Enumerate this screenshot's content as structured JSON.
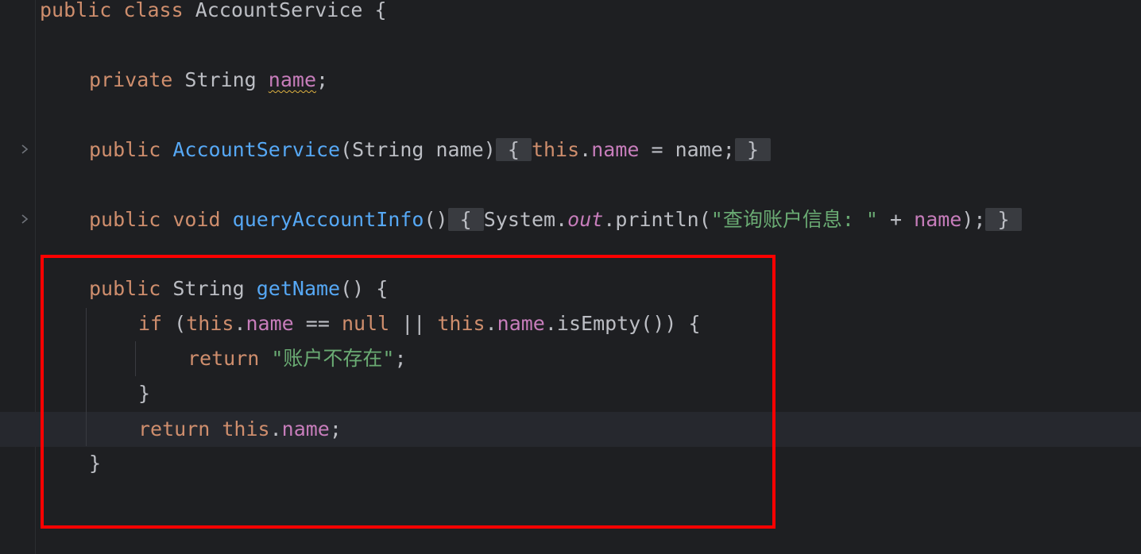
{
  "code": {
    "line1": {
      "kw1": "public",
      "kw2": "class",
      "name": "AccountService",
      "brace": "{"
    },
    "line2": {
      "kw1": "private",
      "type": "String",
      "field": "name",
      "semi": ";"
    },
    "line3": {
      "kw1": "public",
      "fn": "AccountService",
      "params": "(String name)",
      "open": "{",
      "this": "this",
      "dot": ".",
      "field": "name",
      "rest": " = name;",
      "close": "}"
    },
    "line4": {
      "kw1": "public",
      "kw2": "void",
      "fn": "queryAccountInfo",
      "params": "()",
      "open": "{",
      "sys": "System.",
      "out": "out",
      "call": ".println(",
      "str": "\"查询账户信息: \"",
      "plus": " + ",
      "field": "name",
      "end": ");",
      "close": "}"
    },
    "line5": {
      "kw1": "public",
      "type": "String",
      "fn": "getName",
      "rest": "() {"
    },
    "line6": {
      "kw1": "if",
      "p1": " (",
      "this1": "this",
      "dot1": ".",
      "field1": "name",
      "op": " == ",
      "null": "null",
      "or": " || ",
      "this2": "this",
      "dot2": ".",
      "field2": "name",
      "call": ".isEmpty()) {"
    },
    "line7": {
      "kw1": "return",
      "str": "\"账户不存在\"",
      "semi": ";"
    },
    "line8": {
      "brace": "}"
    },
    "line9": {
      "kw1": "return",
      "this": "this",
      "dot": ".",
      "field": "name",
      "semi": ";"
    },
    "line10": {
      "brace": "}"
    }
  },
  "gutter": {
    "fold_icon_1": "chevron-right-icon",
    "fold_icon_2": "chevron-right-icon"
  },
  "colors": {
    "background": "#1e1f22",
    "keyword": "#cf8e6d",
    "function": "#56a8f5",
    "field": "#c77dbb",
    "string": "#6aab73",
    "text": "#bcbec4",
    "highlight_box": "#ff0000"
  }
}
